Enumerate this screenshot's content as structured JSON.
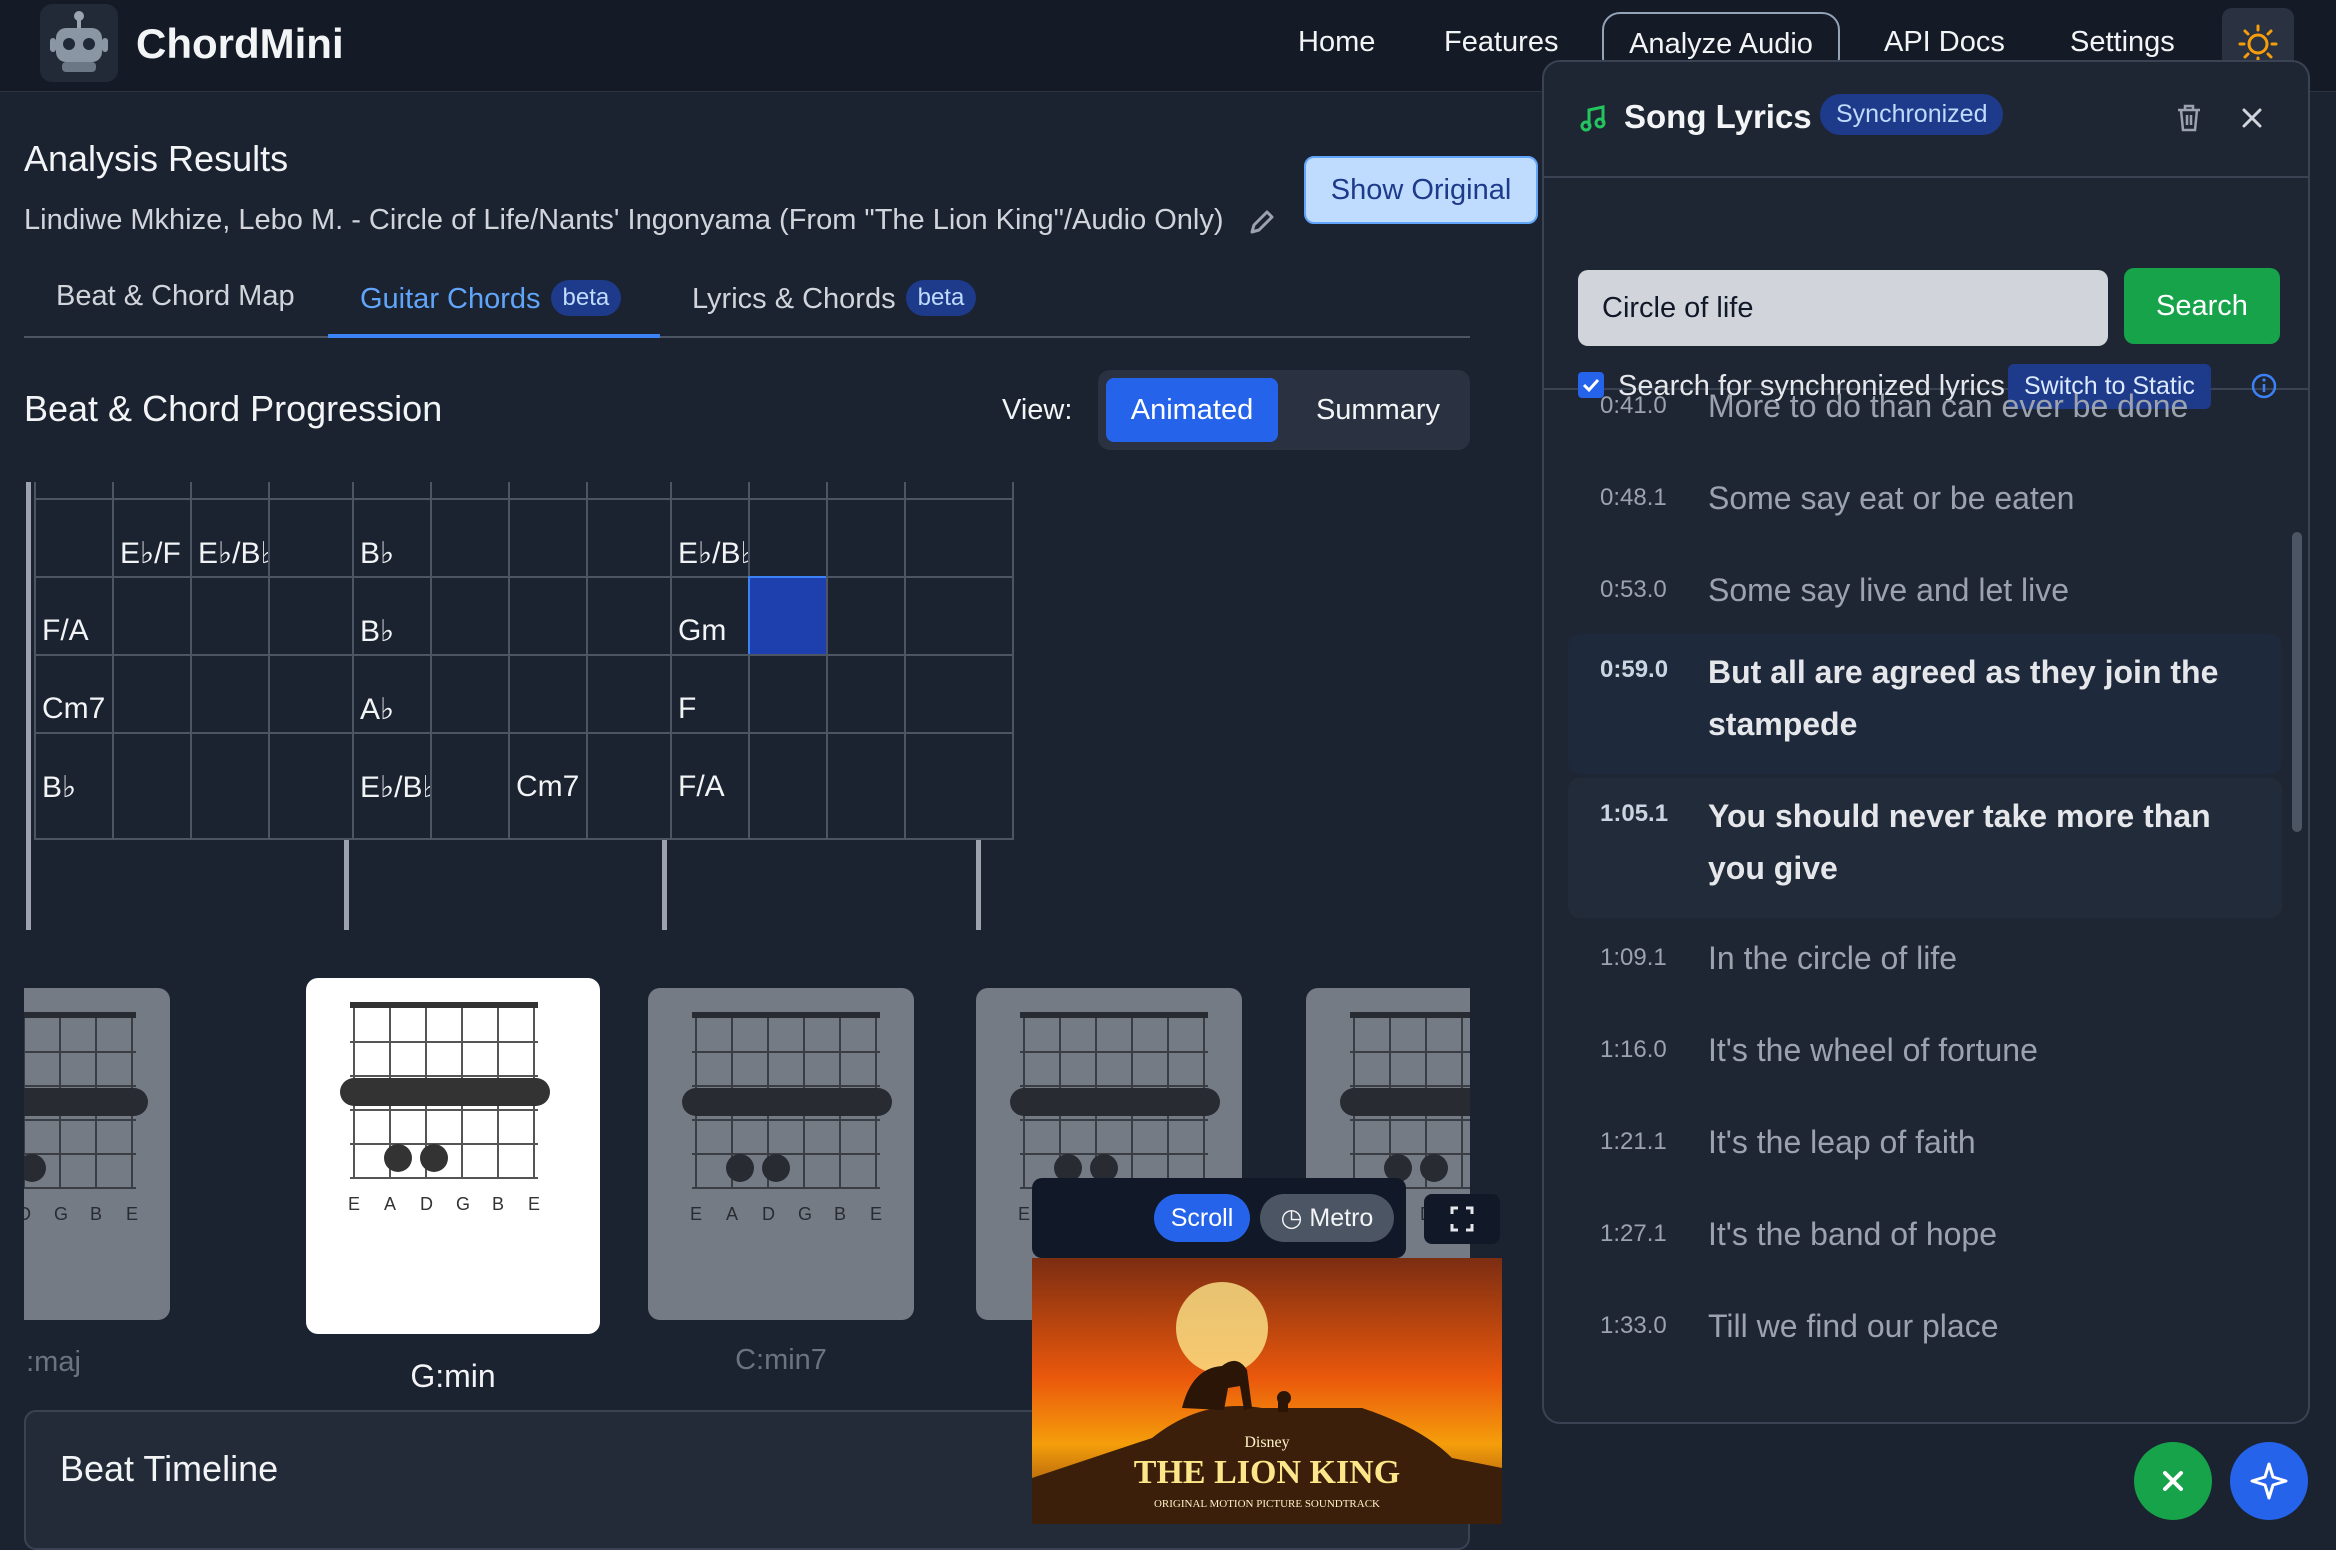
{
  "app": {
    "brand": "ChordMini"
  },
  "nav": {
    "home": "Home",
    "features": "Features",
    "analyze": "Analyze Audio",
    "api_docs": "API Docs",
    "settings": "Settings"
  },
  "results": {
    "title": "Analysis Results",
    "song": "Lindiwe Mkhize, Lebo M. - Circle of Life/Nants' Ingonyama (From \"The Lion King\"/Audio Only)",
    "show_original": "Show Original"
  },
  "tabs": [
    {
      "label": "Beat & Chord Map",
      "badge": ""
    },
    {
      "label": "Guitar Chords",
      "badge": "beta"
    },
    {
      "label": "Lyrics & Chords",
      "badge": "beta"
    }
  ],
  "progression": {
    "title": "Beat & Chord Progression",
    "view_label": "View:",
    "view_animated": "Animated",
    "view_summary": "Summary"
  },
  "grid_rows": [
    [
      "",
      "",
      "",
      "",
      "",
      "",
      "",
      "",
      "",
      "",
      "",
      ""
    ],
    [
      "",
      "E♭/F",
      "E♭/B♭",
      "",
      "B♭",
      "",
      "",
      "",
      "E♭/B♭",
      "",
      "",
      ""
    ],
    [
      "F/A",
      "",
      "",
      "",
      "B♭",
      "",
      "",
      "",
      "Gm",
      "",
      "",
      ""
    ],
    [
      "Cm7",
      "",
      "",
      "",
      "A♭",
      "",
      "",
      "",
      "F",
      "",
      "",
      ""
    ],
    [
      "B♭",
      "",
      "",
      "",
      "E♭/B♭",
      "",
      "Cm7",
      "",
      "F/A",
      "",
      "",
      ""
    ]
  ],
  "diagrams": [
    {
      "label": "B♭:maj"
    },
    {
      "label": "G:min"
    },
    {
      "label": "C:min7"
    },
    {
      "label": ""
    },
    {
      "label": ""
    }
  ],
  "diagram_strings": [
    "E",
    "A",
    "D",
    "G",
    "B",
    "E"
  ],
  "timeline": {
    "title": "Beat Timeline"
  },
  "video": {
    "scroll": "Scroll",
    "metro": "Metro",
    "poster_brand": "Disney",
    "poster_title": "THE LION KING",
    "poster_sub": "ORIGINAL MOTION PICTURE SOUNDTRACK"
  },
  "lyrics": {
    "title": "Song Lyrics",
    "badge": "Synchronized",
    "search_value": "Circle of life",
    "search_button": "Search",
    "sync_label": "Search for synchronized lyrics",
    "switch_static": "Switch to Static",
    "lines": [
      {
        "time": "0:41.0",
        "text": "More to do than can ever be done"
      },
      {
        "time": "0:48.1",
        "text": "Some say eat or be eaten"
      },
      {
        "time": "0:53.0",
        "text": "Some say live and let live"
      },
      {
        "time": "0:59.0",
        "text": "But all are agreed as they join the stampede"
      },
      {
        "time": "1:05.1",
        "text": "You should never take more than you give"
      },
      {
        "time": "1:09.1",
        "text": "In the circle of life"
      },
      {
        "time": "1:16.0",
        "text": "It's the wheel of fortune"
      },
      {
        "time": "1:21.1",
        "text": "It's the leap of faith"
      },
      {
        "time": "1:27.1",
        "text": "It's the band of hope"
      },
      {
        "time": "1:33.0",
        "text": "Till we find our place"
      }
    ]
  },
  "colors": {
    "accent": "#2563eb",
    "success": "#16a34a",
    "background": "#1b2230"
  }
}
